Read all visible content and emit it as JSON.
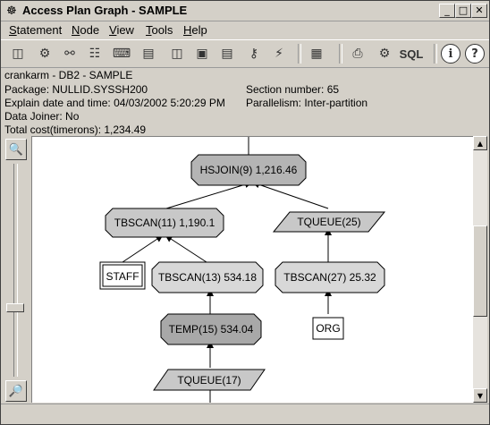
{
  "window": {
    "title": "Access Plan Graph - SAMPLE",
    "icon": "db2-app-icon"
  },
  "menu": [
    {
      "label": "Statement",
      "mnemonic": "S",
      "rest": "tatement"
    },
    {
      "label": "Node",
      "mnemonic": "N",
      "rest": "ode"
    },
    {
      "label": "View",
      "mnemonic": "V",
      "rest": "iew"
    },
    {
      "label": "Tools",
      "mnemonic": "T",
      "rest": "ools"
    },
    {
      "label": "Help",
      "mnemonic": "H",
      "rest": "elp"
    }
  ],
  "toolbar": {
    "sql_label": "SQL",
    "info_label": "i",
    "help_label": "?"
  },
  "info": {
    "connection": "crankarm - DB2 - SAMPLE",
    "package": "Package: NULLID.SYSSH200",
    "section": "Section number: 65",
    "explain_date": "Explain date and time: 04/03/2002 5:20:29 PM",
    "parallelism": "Parallelism: Inter-partition",
    "data_joiner": "Data Joiner: No",
    "total_cost": "Total cost(timerons): 1,234.49"
  },
  "graph": {
    "nodes": {
      "hsjoin": "HSJOIN(9) 1,216.46",
      "tbscan11": "TBSCAN(11) 1,190.1",
      "tqueue25": "TQUEUE(25)",
      "staff": "STAFF",
      "tbscan13": "TBSCAN(13) 534.18",
      "tbscan27": "TBSCAN(27) 25.32",
      "temp15": "TEMP(15) 534.04",
      "org": "ORG",
      "tqueue17": "TQUEUE(17)"
    }
  },
  "colors": {
    "operator_fill": "#c8c8c8",
    "operator_dark": "#a8a8a8",
    "table_fill": "#d4d0c8"
  }
}
